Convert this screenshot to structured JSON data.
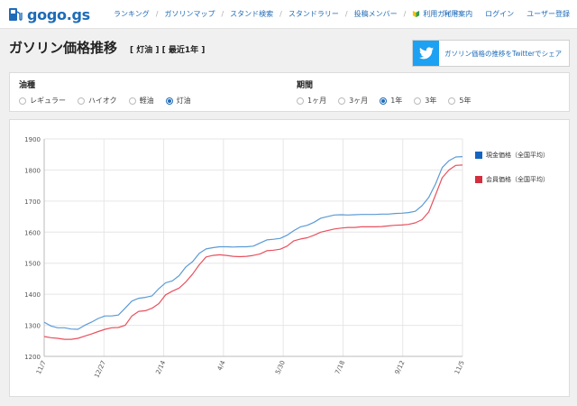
{
  "header": {
    "logo_text": "gogo.gs",
    "nav": [
      "ランキング",
      "ガソリンマップ",
      "スタンド検索",
      "スタンドラリー",
      "投稿メンバー",
      "利用ガイド"
    ],
    "right": [
      "利用案内",
      "ログイン",
      "ユーザー登録"
    ]
  },
  "page": {
    "title": "ガソリン価格推移",
    "subtitle": "[ 灯油 ] [ 最近1年 ]",
    "twitter_label": "ガソリン価格の推移をTwitterでシェア"
  },
  "filters": {
    "fuel": {
      "label": "油種",
      "options": [
        "レギュラー",
        "ハイオク",
        "軽油",
        "灯油"
      ],
      "selected": 3
    },
    "period": {
      "label": "期間",
      "options": [
        "1ヶ月",
        "3ヶ月",
        "1年",
        "3年",
        "5年"
      ],
      "selected": 2
    }
  },
  "colors": {
    "brand": "#1e6bb8",
    "cash": "#5b9bd5",
    "member": "#e8515e",
    "cash_legend": "#1565c0",
    "member_legend": "#d32f3f",
    "twitter": "#1da1f2"
  },
  "chart_data": {
    "type": "line",
    "ylim": [
      1200,
      1900
    ],
    "yticks": [
      1200,
      1300,
      1400,
      1500,
      1600,
      1700,
      1800,
      1900
    ],
    "xtick_labels": [
      "11/7",
      "12/27",
      "2/14",
      "4/4",
      "5/30",
      "7/18",
      "9/12",
      "11/5"
    ],
    "grid": true,
    "legend_position": "right",
    "series": [
      {
        "name": "現金価格（全国平均）",
        "values": [
          1310,
          1298,
          1292,
          1292,
          1288,
          1287,
          1300,
          1310,
          1322,
          1330,
          1330,
          1333,
          1355,
          1378,
          1387,
          1390,
          1395,
          1418,
          1437,
          1443,
          1460,
          1488,
          1505,
          1532,
          1546,
          1550,
          1553,
          1553,
          1552,
          1553,
          1553,
          1555,
          1565,
          1575,
          1577,
          1580,
          1590,
          1605,
          1617,
          1622,
          1632,
          1645,
          1650,
          1655,
          1656,
          1655,
          1656,
          1657,
          1657,
          1657,
          1658,
          1658,
          1660,
          1661,
          1663,
          1667,
          1685,
          1712,
          1755,
          1808,
          1830,
          1842,
          1843
        ]
      },
      {
        "name": "会員価格（全国平均）",
        "values": [
          1264,
          1260,
          1258,
          1255,
          1255,
          1258,
          1265,
          1272,
          1280,
          1287,
          1292,
          1293,
          1300,
          1330,
          1345,
          1347,
          1355,
          1370,
          1398,
          1410,
          1420,
          1440,
          1465,
          1495,
          1520,
          1525,
          1527,
          1525,
          1522,
          1521,
          1522,
          1525,
          1530,
          1540,
          1542,
          1545,
          1555,
          1572,
          1578,
          1582,
          1590,
          1600,
          1605,
          1610,
          1613,
          1615,
          1615,
          1617,
          1617,
          1617,
          1618,
          1620,
          1622,
          1623,
          1625,
          1630,
          1640,
          1665,
          1720,
          1775,
          1800,
          1815,
          1816
        ]
      }
    ]
  }
}
